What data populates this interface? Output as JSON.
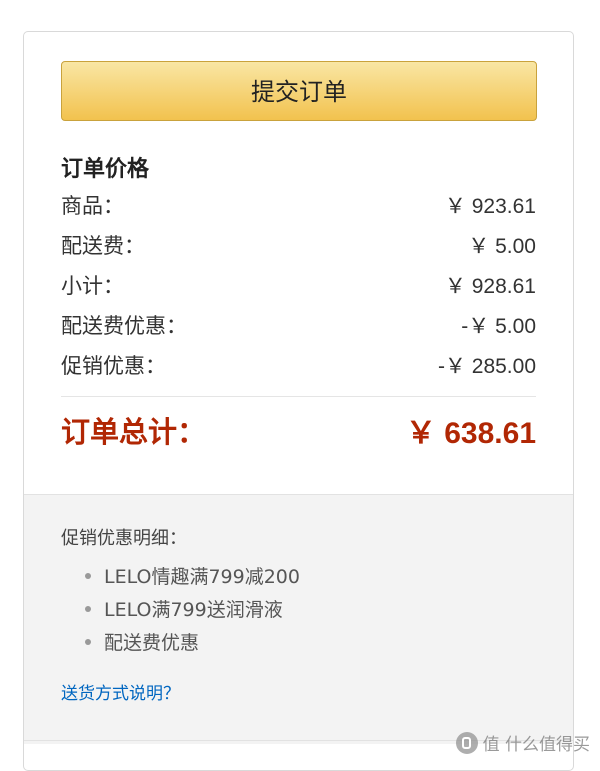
{
  "submit_button": {
    "label": "提交订单"
  },
  "order_price": {
    "title": "订单价格",
    "rows": [
      {
        "label": "商品：",
        "value": "￥ 923.61"
      },
      {
        "label": "配送费：",
        "value": "￥ 5.00"
      },
      {
        "label": "小计：",
        "value": "￥ 928.61"
      },
      {
        "label": "配送费优惠：",
        "value": "-￥ 5.00"
      },
      {
        "label": "促销优惠：",
        "value": "-￥ 285.00"
      }
    ],
    "total": {
      "label": "订单总计：",
      "value": "￥ 638.61"
    }
  },
  "promotions": {
    "heading": "促销优惠明细：",
    "items": [
      "LELO情趣满799减200",
      "LELO满799送润滑液",
      "配送费优惠"
    ]
  },
  "shipping_link": "送货方式说明？",
  "watermark": "值 什么值得买",
  "colors": {
    "button_top": "#f9e6a4",
    "button_bottom": "#f2c24e",
    "total": "#b12704",
    "link": "#0066c0"
  }
}
